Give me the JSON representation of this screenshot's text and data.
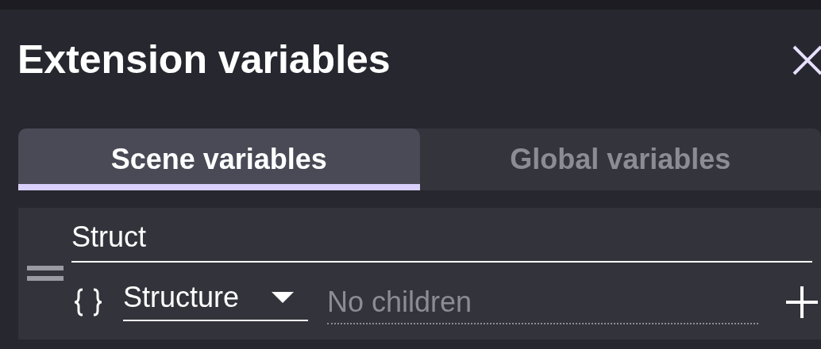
{
  "dialog": {
    "title": "Extension variables"
  },
  "tabs": [
    {
      "label": "Scene variables",
      "selected": true
    },
    {
      "label": "Global variables",
      "selected": false
    }
  ],
  "variables": [
    {
      "name": "Struct",
      "type": "Structure",
      "children_text": "No children"
    }
  ]
}
